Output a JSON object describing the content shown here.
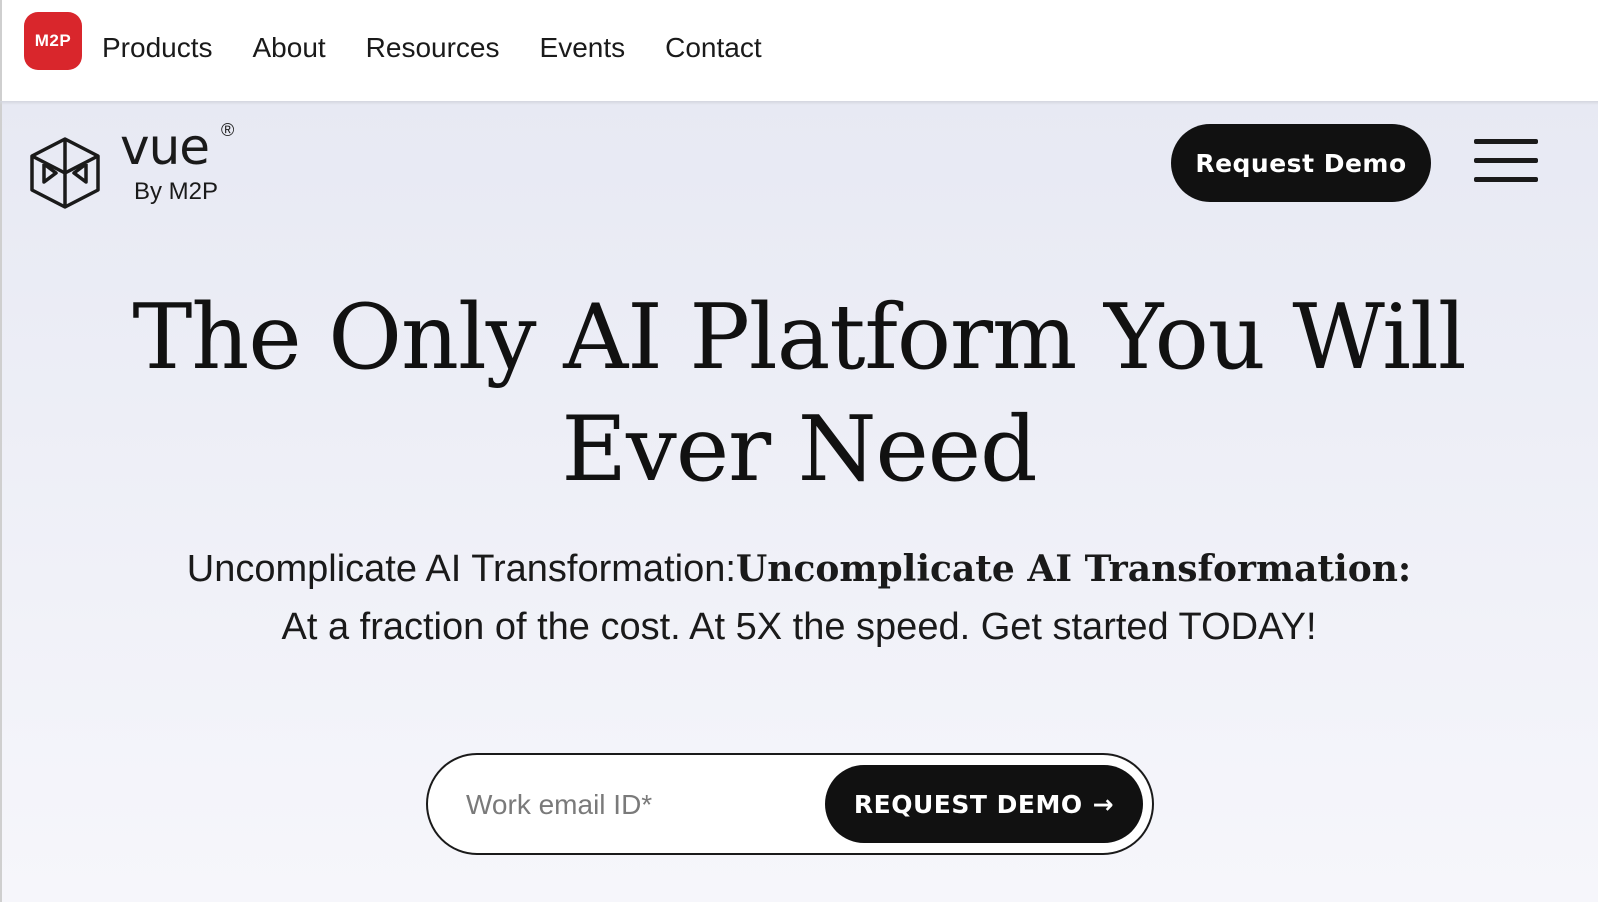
{
  "topbar": {
    "logo_text": "M2P",
    "nav": [
      "Products",
      "About",
      "Resources",
      "Events",
      "Contact"
    ]
  },
  "brand": {
    "name": "vue",
    "registered": "®",
    "byline": "By M2P"
  },
  "header": {
    "cta_label": "Request Demo",
    "menu_icon": "hamburger-menu-icon"
  },
  "hero": {
    "headline_line1": "The Only AI Platform You Will",
    "headline_line2": "Ever Need",
    "subline_regular": "Uncomplicate AI Transformation:",
    "subline_bold": "Uncomplicate AI Transformation:",
    "subline_line2": "At a fraction of the cost. At 5X the speed. Get started TODAY!"
  },
  "form": {
    "email_placeholder": "Work email ID*",
    "email_value": "",
    "submit_label": "REQUEST DEMO",
    "submit_icon": "→"
  },
  "colors": {
    "brand_red": "#d9262c",
    "button_dark": "#111111",
    "hero_bg": "#e7e9f3"
  }
}
